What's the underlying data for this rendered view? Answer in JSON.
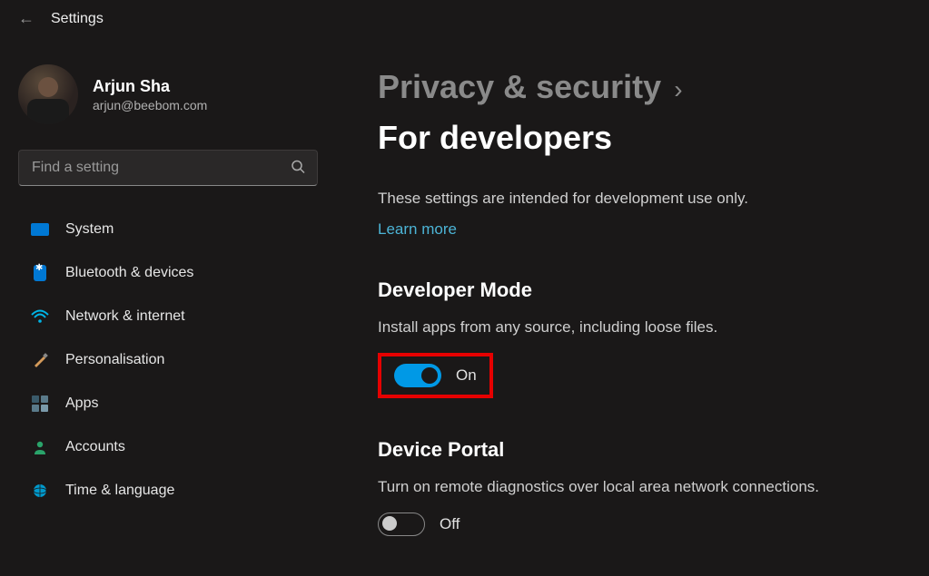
{
  "app_title": "Settings",
  "profile": {
    "name": "Arjun Sha",
    "email": "arjun@beebom.com"
  },
  "search": {
    "placeholder": "Find a setting"
  },
  "sidebar": {
    "items": [
      {
        "label": "System"
      },
      {
        "label": "Bluetooth & devices"
      },
      {
        "label": "Network & internet"
      },
      {
        "label": "Personalisation"
      },
      {
        "label": "Apps"
      },
      {
        "label": "Accounts"
      },
      {
        "label": "Time & language"
      }
    ]
  },
  "breadcrumb": {
    "parent": "Privacy & security",
    "current": "For developers"
  },
  "subtitle": "These settings are intended for development use only.",
  "learn_more": "Learn more",
  "sections": {
    "developer_mode": {
      "title": "Developer Mode",
      "desc": "Install apps from any source, including loose files.",
      "toggle_state": "On"
    },
    "device_portal": {
      "title": "Device Portal",
      "desc": "Turn on remote diagnostics over local area network connections.",
      "toggle_state": "Off"
    }
  },
  "colors": {
    "accent": "#0099e6",
    "link": "#4cb4d6",
    "highlight": "#e60000"
  }
}
